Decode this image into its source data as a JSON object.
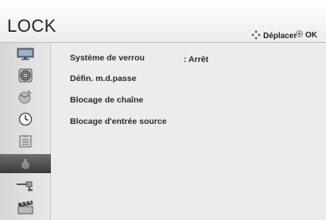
{
  "header": {
    "title": "LOCK",
    "hints": {
      "move_label": "Déplacer",
      "move_icon": "dpad-icon",
      "ok_label": "OK",
      "ok_icon": "ok-button-icon"
    }
  },
  "sidebar": {
    "items": [
      {
        "icon": "picture-icon",
        "active": false
      },
      {
        "icon": "audio-icon",
        "active": false
      },
      {
        "icon": "channel-setup-icon",
        "active": false
      },
      {
        "icon": "time-icon",
        "active": false
      },
      {
        "icon": "option-icon",
        "active": false
      },
      {
        "icon": "lock-icon",
        "active": true
      },
      {
        "icon": "input-icon",
        "active": false
      },
      {
        "icon": "media-icon",
        "active": false
      }
    ]
  },
  "main": {
    "items": [
      {
        "label": "Système de verrou",
        "value": ": Arrêt"
      },
      {
        "label": "Défin. m.d.passe",
        "value": ""
      },
      {
        "label": "Blocage de chaîne",
        "value": ""
      },
      {
        "label": "Blocage d'entrée source",
        "value": ""
      }
    ]
  },
  "colors": {
    "background": "#ececec",
    "sidebar_active": "#4a4a4a",
    "text": "#2a2a2a"
  }
}
